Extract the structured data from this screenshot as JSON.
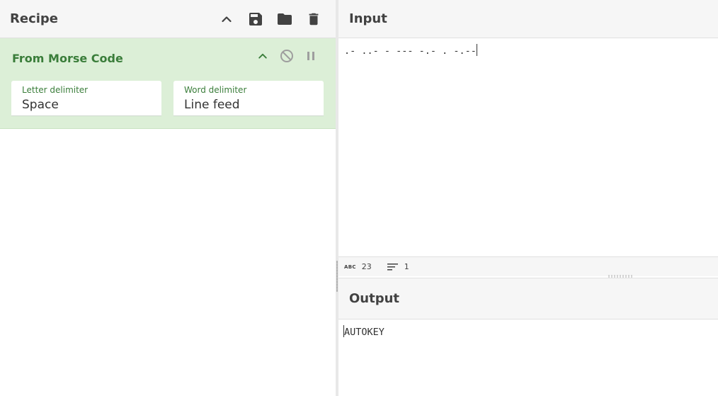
{
  "recipe": {
    "title": "Recipe",
    "header_icons": [
      "chevron-up-icon",
      "save-icon",
      "folder-icon",
      "trash-icon"
    ],
    "operation": {
      "name": "From Morse Code",
      "controls": [
        "chevron-up-icon",
        "disable-icon",
        "pause-icon"
      ],
      "args": [
        {
          "label": "Letter delimiter",
          "value": "Space"
        },
        {
          "label": "Word delimiter",
          "value": "Line feed"
        }
      ]
    }
  },
  "input": {
    "title": "Input",
    "text": ".- ..- - --- -.- . -.--",
    "status": {
      "char_count": "23",
      "line_count": "1"
    }
  },
  "output": {
    "title": "Output",
    "text": "AUTOKEY"
  },
  "colors": {
    "operation_bg": "#dcefd7",
    "operation_accent": "#3a7d3a",
    "header_bg": "#f6f6f6",
    "text": "#424242"
  }
}
